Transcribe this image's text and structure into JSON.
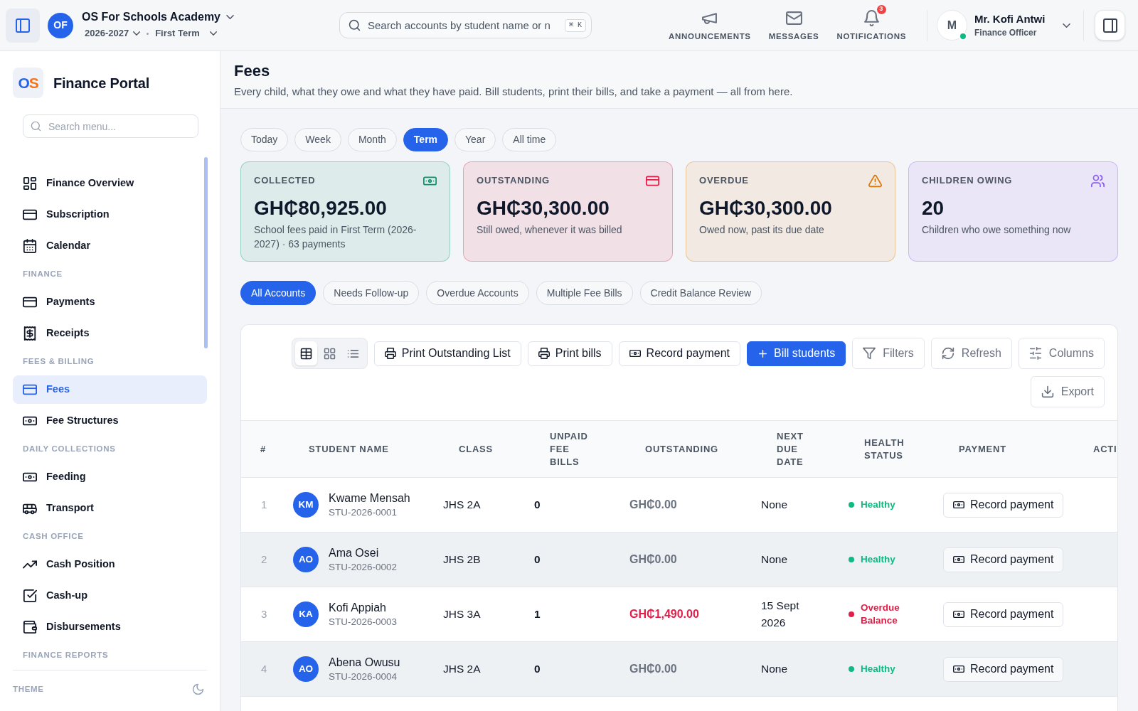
{
  "top_bar": {
    "school": {
      "initials": "OF",
      "name": "OS For Schools Academy",
      "year": "2026-2027",
      "term": "First Term"
    },
    "search": {
      "placeholder": "Search accounts by student name or n",
      "shortcut": "⌘ K"
    },
    "nav": [
      {
        "label": "ANNOUNCEMENTS"
      },
      {
        "label": "MESSAGES"
      },
      {
        "label": "NOTIFICATIONS",
        "badge": "3"
      }
    ],
    "user": {
      "initial": "M",
      "name": "Mr. Kofi Antwi",
      "role": "Finance Officer",
      "online": true
    }
  },
  "sidebar": {
    "brand": {
      "logo": "OS",
      "title": "Finance Portal"
    },
    "search": {
      "placeholder": "Search menu..."
    },
    "sections": [
      {
        "items": [
          {
            "label": "Finance Overview",
            "selected": false
          },
          {
            "label": "Subscription",
            "selected": false
          },
          {
            "label": "Calendar",
            "selected": false
          }
        ]
      },
      {
        "heading": "FINANCE",
        "items": [
          {
            "label": "Payments",
            "selected": false
          },
          {
            "label": "Receipts",
            "selected": false
          }
        ]
      },
      {
        "heading": "FEES & BILLING",
        "items": [
          {
            "label": "Fees",
            "selected": true
          },
          {
            "label": "Fee Structures",
            "selected": false
          }
        ]
      },
      {
        "heading": "DAILY COLLECTIONS",
        "items": [
          {
            "label": "Feeding",
            "selected": false
          },
          {
            "label": "Transport",
            "selected": false
          }
        ]
      },
      {
        "heading": "CASH OFFICE",
        "items": [
          {
            "label": "Cash Position",
            "selected": false
          },
          {
            "label": "Cash-up",
            "selected": false
          },
          {
            "label": "Disbursements",
            "selected": false
          }
        ]
      },
      {
        "heading": "FINANCE REPORTS"
      }
    ],
    "theme": {
      "label": "THEME"
    }
  },
  "page": {
    "title": "Fees",
    "subtitle": "Every child, what they owe and what they have paid. Bill students, print their bills, and take a payment — all from here."
  },
  "periods": [
    {
      "label": "Today",
      "selected": false
    },
    {
      "label": "Week",
      "selected": false
    },
    {
      "label": "Month",
      "selected": false
    },
    {
      "label": "Term",
      "selected": true
    },
    {
      "label": "Year",
      "selected": false
    },
    {
      "label": "All time",
      "selected": false
    }
  ],
  "stats": [
    {
      "label": "COLLECTED",
      "value": "GH₵80,925.00",
      "note": "School fees paid in First Term (2026-2027) · 63 payments",
      "color": "#059669"
    },
    {
      "label": "OUTSTANDING",
      "value": "GH₵30,300.00",
      "note": "Still owed, whenever it was billed",
      "color": "#e11d48"
    },
    {
      "label": "OVERDUE",
      "value": "GH₵30,300.00",
      "note": "Owed now, past its due date",
      "color": "#d97706"
    },
    {
      "label": "CHILDREN OWING",
      "value": "20",
      "note": "Children who owe something now",
      "color": "#8b5cf6"
    }
  ],
  "segments": [
    {
      "label": "All Accounts",
      "selected": true
    },
    {
      "label": "Needs Follow-up",
      "selected": false
    },
    {
      "label": "Overdue Accounts",
      "selected": false
    },
    {
      "label": "Multiple Fee Bills",
      "selected": false
    },
    {
      "label": "Credit Balance Review",
      "selected": false
    }
  ],
  "toolbar": {
    "views": [
      {
        "selected": true
      },
      {
        "selected": false
      },
      {
        "selected": false
      }
    ],
    "actions": [
      {
        "label": "Print Outstanding List",
        "kind": "outline"
      },
      {
        "label": "Print bills",
        "kind": "outline"
      },
      {
        "label": "Record payment",
        "kind": "outline"
      },
      {
        "label": "Bill students",
        "kind": "primary"
      },
      {
        "label": "Filters",
        "kind": "ghost"
      },
      {
        "label": "Refresh",
        "kind": "ghost"
      },
      {
        "label": "Columns",
        "kind": "ghost"
      },
      {
        "label": "Export",
        "kind": "ghost"
      }
    ]
  },
  "table": {
    "columns": [
      "#",
      "STUDENT NAME",
      "CLASS",
      "UNPAID FEE BILLS",
      "OUTSTANDING",
      "NEXT DUE DATE",
      "HEALTH STATUS",
      "PAYMENT",
      "ACTI"
    ],
    "rows": [
      {
        "index": "1",
        "initials": "KM",
        "name": "Kwame Mensah",
        "student_id": "STU-2026-0001",
        "class": "JHS 2A",
        "unpaid_bills": "0",
        "outstanding": "GH₵0.00",
        "overdue": false,
        "next_due": "None",
        "health": {
          "label": "Healthy",
          "color": "#10b981"
        },
        "payment_action": "Record payment"
      },
      {
        "index": "2",
        "initials": "AO",
        "name": "Ama Osei",
        "student_id": "STU-2026-0002",
        "class": "JHS 2B",
        "unpaid_bills": "0",
        "outstanding": "GH₵0.00",
        "overdue": false,
        "next_due": "None",
        "health": {
          "label": "Healthy",
          "color": "#10b981"
        },
        "payment_action": "Record payment"
      },
      {
        "index": "3",
        "initials": "KA",
        "name": "Kofi Appiah",
        "student_id": "STU-2026-0003",
        "class": "JHS 3A",
        "unpaid_bills": "1",
        "outstanding": "GH₵1,490.00",
        "overdue": true,
        "next_due": "15 Sept 2026",
        "health": {
          "label": "Overdue Balance",
          "color": "#e11d48"
        },
        "payment_action": "Record payment"
      },
      {
        "index": "4",
        "initials": "AO",
        "name": "Abena Owusu",
        "student_id": "STU-2026-0004",
        "class": "JHS 2A",
        "unpaid_bills": "0",
        "outstanding": "GH₵0.00",
        "overdue": false,
        "next_due": "None",
        "health": {
          "label": "Healthy",
          "color": "#10b981"
        },
        "payment_action": "Record payment"
      }
    ]
  }
}
